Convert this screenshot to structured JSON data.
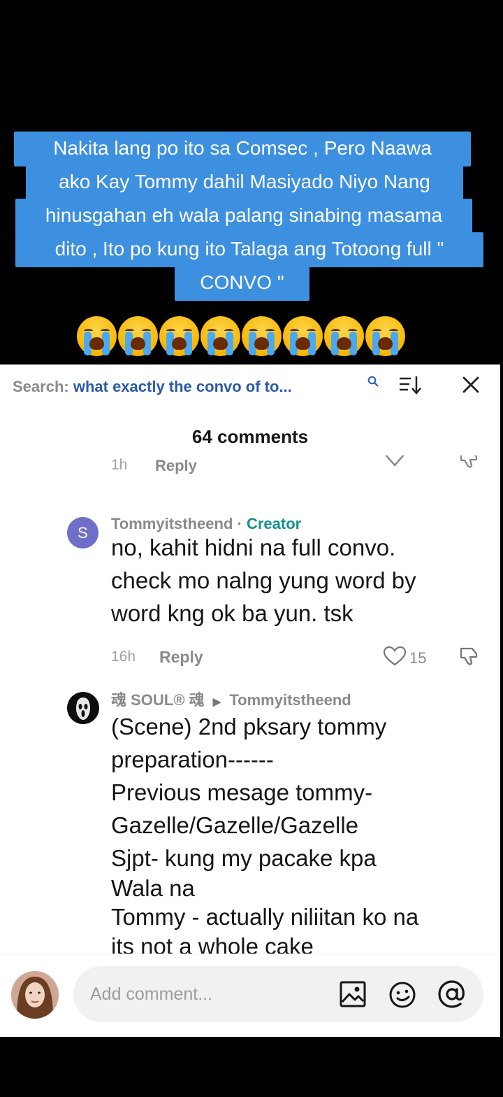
{
  "caption": {
    "lines": [
      "Nakita lang po ito sa Comsec , Pero Naawa",
      "ako Kay Tommy dahil Masiyado Niyo Nang",
      "hinusgahan eh wala palang sinabing masama",
      "dito , Ito po kung ito Talaga ang Totoong full \"",
      "CONVO \""
    ],
    "emoji": "loudly-crying-face",
    "emoji_count": 8
  },
  "search": {
    "label": "Search:",
    "query": "what exactly the convo of to..."
  },
  "comments_count": "64 comments",
  "clipped_row": {
    "time": "1h",
    "reply": "Reply"
  },
  "comments": [
    {
      "avatar_letter": "S",
      "author": "Tommyitstheend",
      "separator": "·",
      "badge": "Creator",
      "lines": [
        "no, kahit hidni na full convo.",
        "check mo nalng yung word by",
        "word kng ok ba yun. tsk"
      ],
      "time": "16h",
      "reply": "Reply",
      "likes": "15"
    },
    {
      "author": "魂 SOUL® 魂",
      "reply_to": "Tommyitstheend",
      "lines": [
        "(Scene) 2nd pksary tommy",
        "preparation------",
        "Previous mesage tommy-",
        "Gazelle/Gazelle/Gazelle",
        "Sjpt- kung my pacake kpa",
        "Wala na",
        "Tommy - actually niliitan ko na",
        "its not a whole cake"
      ]
    }
  ],
  "composer": {
    "placeholder": "Add comment..."
  },
  "colors": {
    "caption_bg": "#3d8fe0",
    "creator": "#15928a",
    "search_query": "#2b5aa8",
    "avatar_s": "#6f6fc9"
  }
}
